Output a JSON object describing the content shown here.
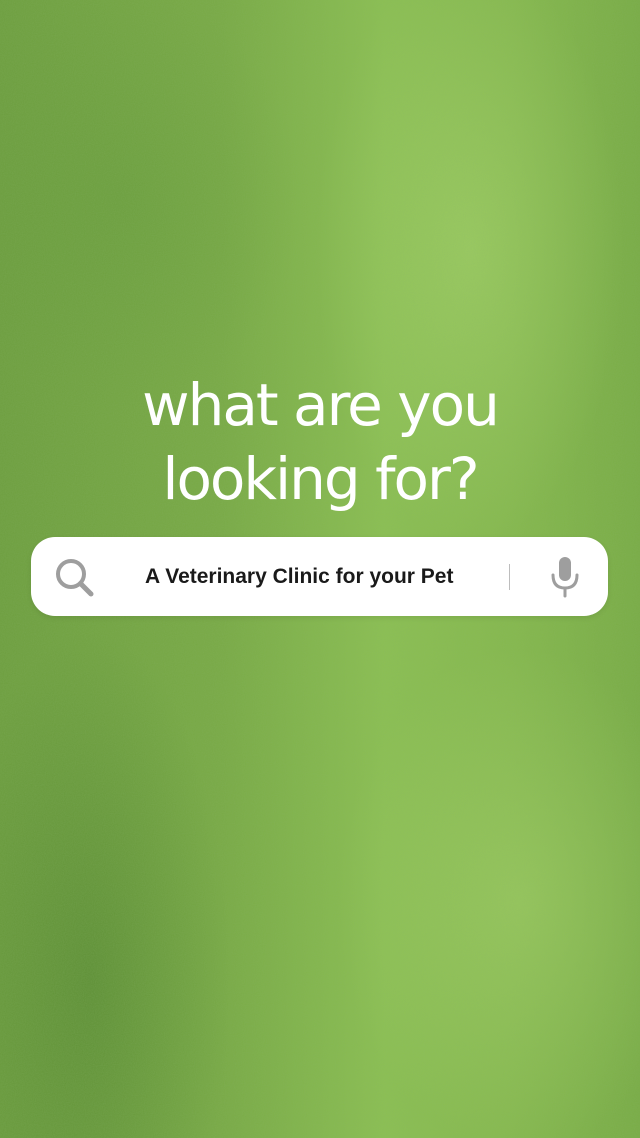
{
  "headline": {
    "line1": "what are you",
    "line2": "looking for?"
  },
  "search": {
    "query": "A Veterinary Clinic for your Pet",
    "leading_icon": "search-icon",
    "trailing_icon": "microphone-icon"
  },
  "colors": {
    "background": "#7fb148",
    "headline_text": "#ffffff",
    "search_bar": "#ffffff",
    "search_text": "#1a1a1a",
    "icon": "#9e9e9e"
  }
}
